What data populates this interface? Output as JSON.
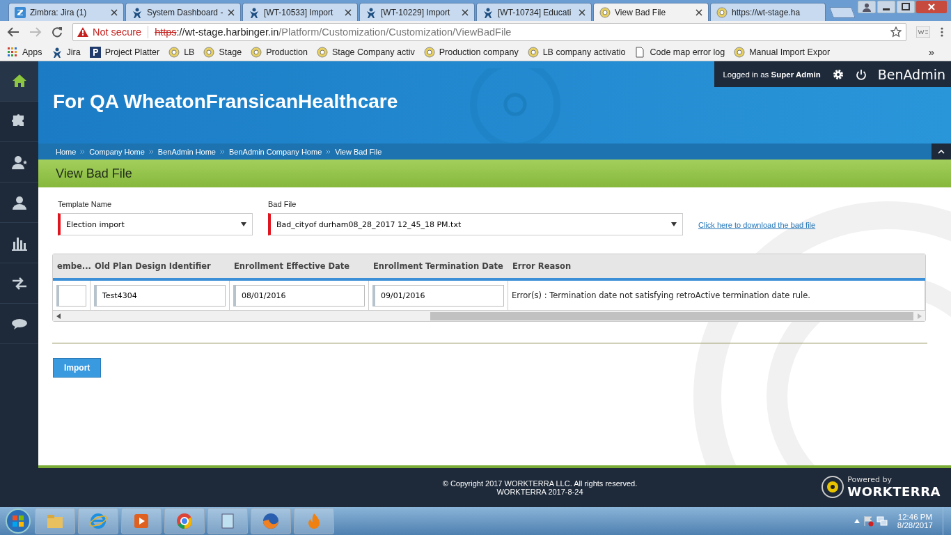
{
  "browser": {
    "tabs": [
      {
        "title": "Zimbra: Jira (1)",
        "selected": false,
        "closable": true
      },
      {
        "title": "System Dashboard -",
        "selected": false,
        "closable": true
      },
      {
        "title": "[WT-10533] Import",
        "selected": false,
        "closable": true
      },
      {
        "title": "[WT-10229] Import",
        "selected": false,
        "closable": true
      },
      {
        "title": "[WT-10734] Educati",
        "selected": false,
        "closable": true
      },
      {
        "title": "View Bad File",
        "selected": true,
        "closable": true
      },
      {
        "title": "https://wt-stage.ha",
        "selected": false,
        "closable": false
      }
    ],
    "address": {
      "warning": "Not secure",
      "scheme": "https",
      "host": "://wt-stage.harbinger.in",
      "path": "/Platform/Customization/Customization/ViewBadFile"
    },
    "bookmarks": [
      "Apps",
      "Jira",
      "Project Platter",
      "LB",
      "Stage",
      "Production",
      "Stage Company activ",
      "Production company",
      "LB company activatio",
      "Code map error log",
      "Manual Import Expor"
    ],
    "more": "»"
  },
  "sidebar": [
    {
      "selected": true
    },
    {
      "selected": false
    },
    {
      "selected": false
    },
    {
      "selected": false
    },
    {
      "selected": false
    },
    {
      "selected": false
    },
    {
      "selected": false
    }
  ],
  "header": {
    "title": "For QA WheatonFransicanHealthcare",
    "login": "Logged in as **Super Admin**",
    "app": "BenAdmin"
  },
  "breadcrumbs": [
    "Home",
    "Company Home",
    "BenAdmin Home",
    "BenAdmin Company Home",
    "View Bad File"
  ],
  "page_title": "View Bad File",
  "form": {
    "fields": [
      {
        "label": "Template Name",
        "value": "Election import",
        "required": true
      },
      {
        "label": "Bad File",
        "value": "Bad_cityof durham08_28_2017 12_45_18 PM.txt",
        "required": true
      }
    ],
    "download_link": "Click here to download the bad file"
  },
  "table": {
    "columns": [
      "embe...",
      "Old Plan Design Identifier",
      "Enrollment Effective Date",
      "Enrollment Termination Date",
      "Error Reason"
    ],
    "rows": [
      [
        {
          "kind": "input"
        },
        {
          "kind": "input",
          "value": "Test4304"
        },
        {
          "kind": "input",
          "value": "08/01/2016"
        },
        {
          "kind": "input",
          "value": "09/01/2016"
        },
        {
          "kind": "text",
          "value": "Error(s) : Termination date not satisfying retroActive termination date rule."
        }
      ]
    ]
  },
  "import_button": "Import",
  "footer": {
    "copyright": "© Copyright 2017 WORKTERRA LLC. All rights reserved.",
    "version": "WORKTERRA 2017-8-24",
    "powered_by": "Powered by",
    "brand": "WORKTERRA"
  },
  "taskbar": {
    "time": "12:46 PM",
    "date": "8/28/2017"
  }
}
